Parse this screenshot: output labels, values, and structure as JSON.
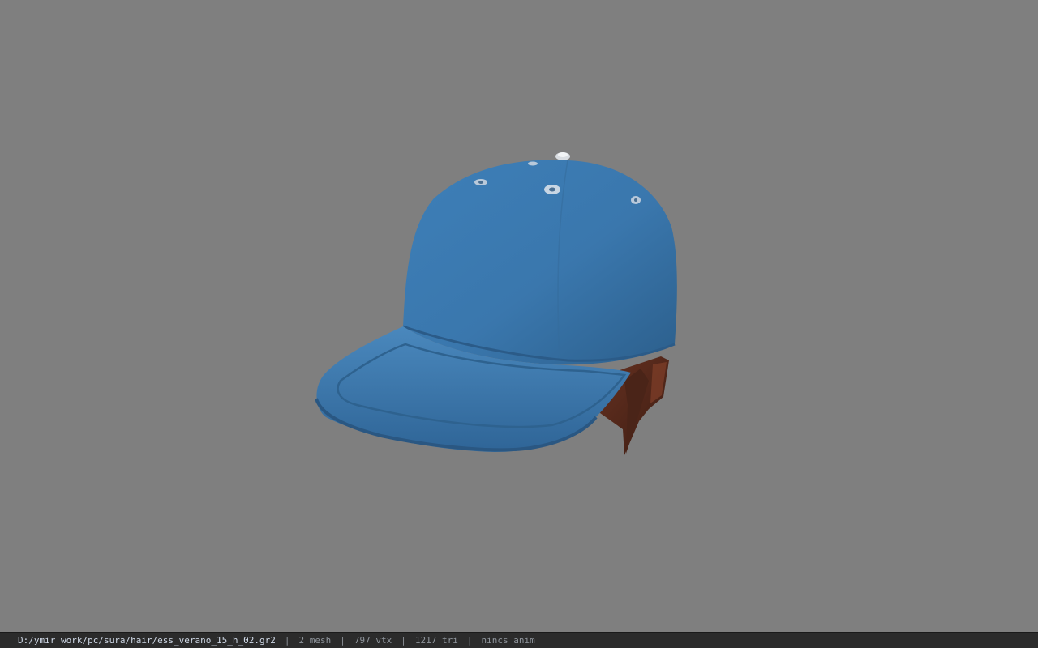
{
  "viewport": {
    "background_color": "#7f7f7f",
    "model": {
      "name": "baseball-cap-with-hair",
      "cap_color": "#3f78a8",
      "hair_color": "#5a2a1c"
    }
  },
  "status_bar": {
    "file_path": "D:/ymir work/pc/sura/hair/ess_verano_15_h_02.gr2",
    "separator": "|",
    "mesh_count": "2 mesh",
    "vertex_count": "797 vtx",
    "triangle_count": "1217 tri",
    "anim_status": "nincs anim"
  }
}
